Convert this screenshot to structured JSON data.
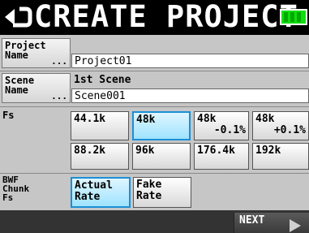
{
  "header": {
    "title": "CREATE PROJECT",
    "back_icon": "back-arrow-icon",
    "battery_icon": "battery-icon"
  },
  "project_name": {
    "label_line1": "Project",
    "label_line2": "Name",
    "dots": "...",
    "value": "Project01"
  },
  "scene_name": {
    "label_line1": "Scene",
    "label_line2": "Name",
    "dots": "...",
    "caption": "1st Scene",
    "value": "Scene001"
  },
  "fs": {
    "label": "Fs",
    "options": [
      {
        "line1": "44.1k",
        "line2": ""
      },
      {
        "line1": "48k",
        "line2": ""
      },
      {
        "line1": "48k",
        "line2": "-0.1%"
      },
      {
        "line1": "48k",
        "line2": "+0.1%"
      },
      {
        "line1": "88.2k",
        "line2": ""
      },
      {
        "line1": "96k",
        "line2": ""
      },
      {
        "line1": "176.4k",
        "line2": ""
      },
      {
        "line1": "192k",
        "line2": ""
      }
    ],
    "selected": "48k"
  },
  "bwf": {
    "label_line1": "BWF",
    "label_line2": "Chunk",
    "label_line3": "Fs",
    "options": [
      {
        "line1": "Actual",
        "line2": "Rate"
      },
      {
        "line1": "Fake",
        "line2": "Rate"
      }
    ],
    "selected": "Actual Rate"
  },
  "footer": {
    "next_label": "NEXT",
    "next_icon": "right-arrow-icon"
  }
}
